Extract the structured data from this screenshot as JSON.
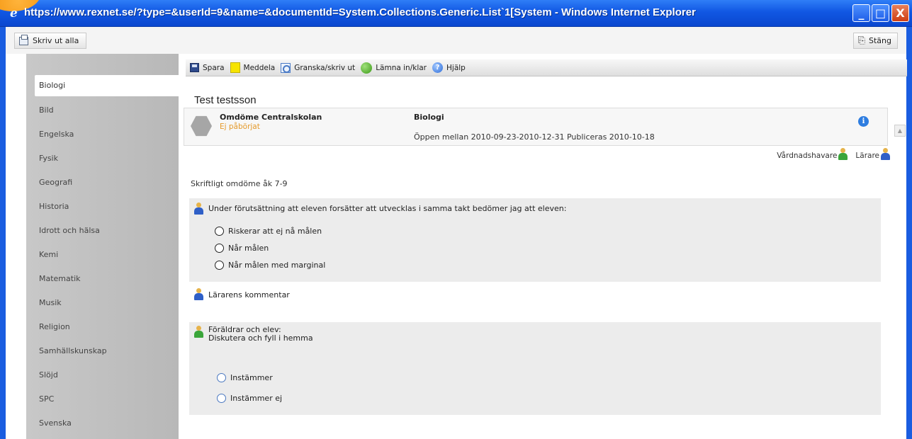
{
  "window": {
    "title": "https://www.rexnet.se/?type=&userId=9&name=&documentId=System.Collections.Generic.List`1[System - Windows Internet Explorer",
    "minimize": "_",
    "maximize": "□",
    "close": "X"
  },
  "toolbar": {
    "print_all": "Skriv ut alla",
    "close": "Stäng"
  },
  "sidebar": {
    "items": [
      {
        "label": "Biologi",
        "active": true
      },
      {
        "label": "Bild"
      },
      {
        "label": "Engelska"
      },
      {
        "label": "Fysik"
      },
      {
        "label": "Geografi"
      },
      {
        "label": "Historia"
      },
      {
        "label": "Idrott och hälsa"
      },
      {
        "label": "Kemi"
      },
      {
        "label": "Matematik"
      },
      {
        "label": "Musik"
      },
      {
        "label": "Religion"
      },
      {
        "label": "Samhällskunskap"
      },
      {
        "label": "Slöjd"
      },
      {
        "label": "SPC"
      },
      {
        "label": "Svenska"
      }
    ]
  },
  "actions": {
    "save": "Spara",
    "notify": "Meddela",
    "review_print": "Granska/skriv ut",
    "submit": "Lämna in/klar",
    "help": "Hjälp"
  },
  "student": {
    "name": "Test testsson"
  },
  "assessment": {
    "title": "Omdöme Centralskolan",
    "status": "Ej påbörjat",
    "subject": "Biologi",
    "period": "Öppen mellan 2010-09-23-2010-12-31  Publiceras 2010-10-18",
    "info_icon": "i"
  },
  "roles": {
    "guardian": "Vårdnadshavare",
    "teacher": "Lärare"
  },
  "form": {
    "section_title": "Skriftligt omdöme åk 7-9",
    "question": "Under förutsättning att eleven forsätter att utvecklas i samma takt bedömer jag att eleven:",
    "options": [
      "Riskerar att ej nå målen",
      "Når målen",
      "Når målen med marginal"
    ],
    "teacher_comment": "Lärarens kommentar",
    "parents_line1": "Föräldrar och elev:",
    "parents_line2": "Diskutera och fyll i hemma",
    "agree_options": [
      "Instämmer",
      "Instämmer ej"
    ]
  },
  "colors": {
    "titlebar": "#1157e3",
    "status_orange": "#e59a2a",
    "sidebar_gray": "#c0c0c0",
    "panel_gray": "#ececec"
  }
}
